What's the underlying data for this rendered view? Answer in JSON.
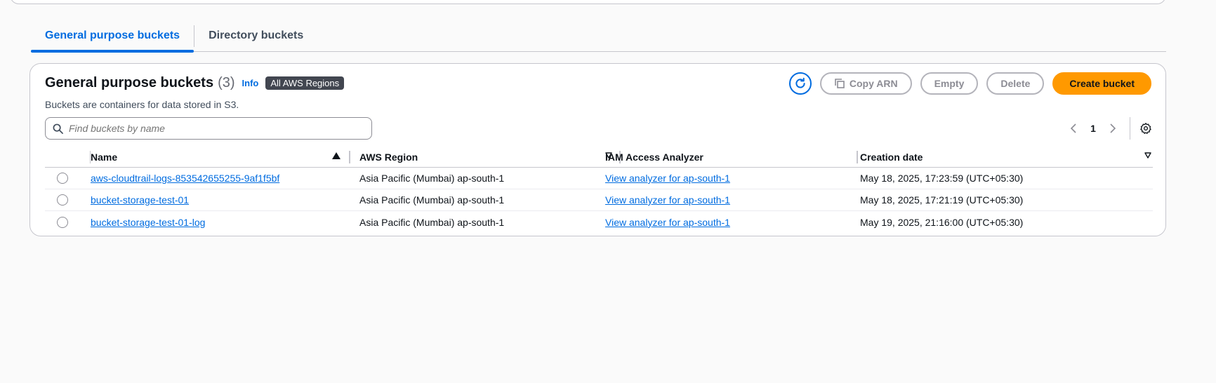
{
  "tabs": [
    {
      "label": "General purpose buckets",
      "active": true
    },
    {
      "label": "Directory buckets",
      "active": false
    }
  ],
  "panel": {
    "title": "General purpose buckets",
    "count": "(3)",
    "info": "Info",
    "region_badge": "All AWS Regions",
    "description": "Buckets are containers for data stored in S3."
  },
  "actions": {
    "refresh_icon": "refresh-icon",
    "copy_arn": "Copy ARN",
    "empty": "Empty",
    "delete": "Delete",
    "create": "Create bucket"
  },
  "search": {
    "placeholder": "Find buckets by name",
    "value": ""
  },
  "pagination": {
    "current_page": "1"
  },
  "table": {
    "columns": {
      "name": "Name",
      "region": "AWS Region",
      "iam": "IAM Access Analyzer",
      "date": "Creation date"
    },
    "rows": [
      {
        "name": "aws-cloudtrail-logs-853542655255-9af1f5bf",
        "region": "Asia Pacific (Mumbai) ap-south-1",
        "iam": "View analyzer for ap-south-1",
        "date": "May 18, 2025, 17:23:59 (UTC+05:30)"
      },
      {
        "name": "bucket-storage-test-01",
        "region": "Asia Pacific (Mumbai) ap-south-1",
        "iam": "View analyzer for ap-south-1",
        "date": "May 18, 2025, 17:21:19 (UTC+05:30)"
      },
      {
        "name": "bucket-storage-test-01-log",
        "region": "Asia Pacific (Mumbai) ap-south-1",
        "iam": "View analyzer for ap-south-1",
        "date": "May 19, 2025, 21:16:00 (UTC+05:30)"
      }
    ]
  },
  "colors": {
    "accent": "#006ce0",
    "primary_button": "#ff9900",
    "badge": "#424650"
  }
}
